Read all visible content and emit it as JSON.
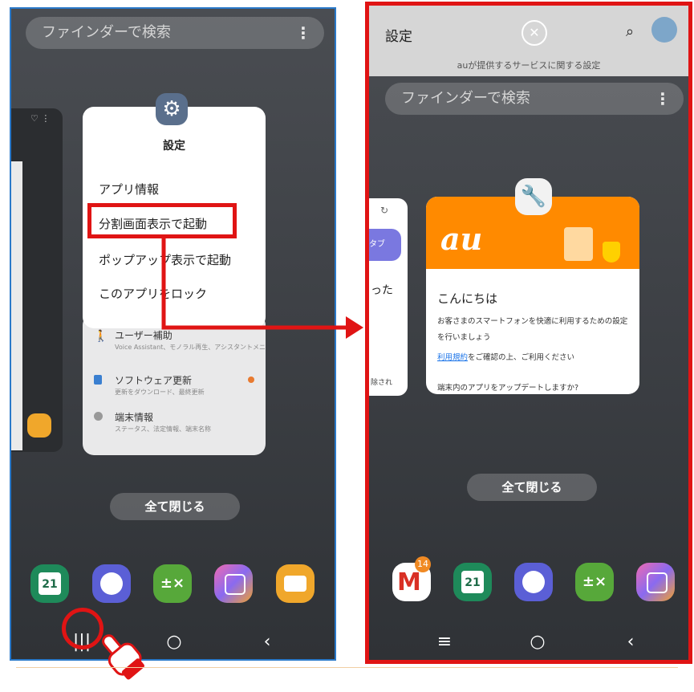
{
  "left": {
    "finder": {
      "placeholder": "ファインダーで検索"
    },
    "settings_popup": {
      "title": "設定",
      "items": [
        "アプリ情報",
        "分割画面表示で起動",
        "ポップアップ表示で起動",
        "このアプリをロック"
      ]
    },
    "settings_rows": [
      {
        "title": "ユーザー補助",
        "sub": "Voice Assistant、モノラル再生、アシスタントメニュー"
      },
      {
        "title": "ソフトウェア更新",
        "sub": "更新をダウンロード、最終更新"
      },
      {
        "title": "端末情報",
        "sub": "ステータス、法定情報、端末名称"
      }
    ],
    "close_all": "全て閉じる",
    "dock": [
      {
        "icon": "calendar-icon",
        "text": "21",
        "color": "#1e8a5a"
      },
      {
        "icon": "clock-icon",
        "color": "#5b5fd6"
      },
      {
        "icon": "calculator-icon",
        "color": "#57a83a"
      },
      {
        "icon": "store-icon",
        "color": "#e26ad0"
      },
      {
        "icon": "folder-icon",
        "color": "#f0a72b"
      }
    ]
  },
  "right": {
    "header": {
      "title": "設定",
      "subtitle": "auが提供するサービスに関する設定"
    },
    "finder": {
      "placeholder": "ファインダーで検索"
    },
    "side_card": {
      "tag": "タブ",
      "text": "った",
      "note": "除され"
    },
    "au_card": {
      "logo": "au",
      "heading": "こんにちは",
      "body": "お客さまのスマートフォンを快適に利用するための設定を行いましょう",
      "link": "利用規約",
      "link_rest": "をご確認の上、ご利用ください",
      "question": "端末内のアプリをアップデートしますか?"
    },
    "close_all": "全て閉じる",
    "gmail_badge": "14",
    "dock": [
      {
        "icon": "gmail-icon",
        "color": "#ffffff"
      },
      {
        "icon": "calendar-icon",
        "text": "21",
        "color": "#1e8a5a"
      },
      {
        "icon": "clock-icon",
        "color": "#5b5fd6"
      },
      {
        "icon": "calculator-icon",
        "color": "#57a83a"
      },
      {
        "icon": "store-icon",
        "color": "#e26ad0"
      }
    ]
  },
  "colors": {
    "highlight": "#e01414",
    "accent_blue": "#2a79c9",
    "au_orange": "#ff8a00"
  }
}
